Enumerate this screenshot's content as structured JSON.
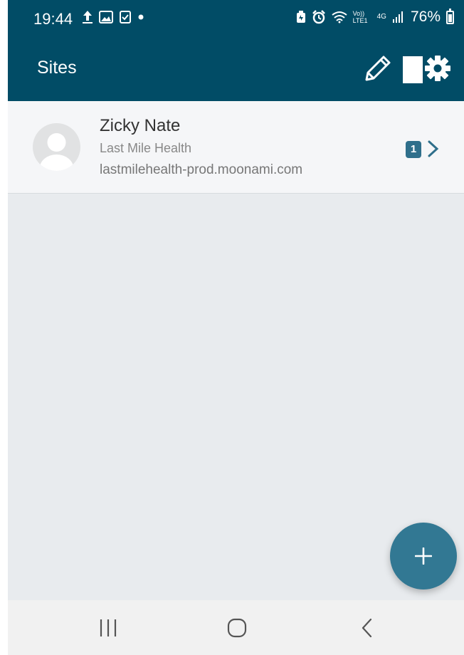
{
  "status_bar": {
    "time": "19:44",
    "battery_percent": "76%",
    "left_icons": [
      "upload-icon",
      "image-icon",
      "clipboard-check-icon",
      "dot-icon"
    ],
    "right_icons": [
      "battery-saver-icon",
      "alarm-icon",
      "wifi-icon",
      "volte-icon",
      "4g-icon",
      "signal-icon",
      "battery-icon"
    ],
    "volte_label": "Vo)) LTE1",
    "network_label": "4G"
  },
  "app_bar": {
    "title": "Sites",
    "actions": [
      "edit-icon",
      "settings-icon"
    ]
  },
  "sites": [
    {
      "name": "Zicky Nate",
      "organization": "Last Mile Health",
      "url": "lastmilehealth-prod.moonami.com",
      "badge_count": "1"
    }
  ],
  "fab": {
    "icon": "plus-icon"
  },
  "nav_bar": {
    "buttons": [
      "recent-apps-icon",
      "home-icon",
      "back-icon"
    ]
  },
  "colors": {
    "app_bar_bg": "#014c66",
    "list_bg": "#e8ebee",
    "row_bg": "#f5f6f8",
    "accent": "#327893",
    "badge_bg": "#2f6f8b"
  }
}
